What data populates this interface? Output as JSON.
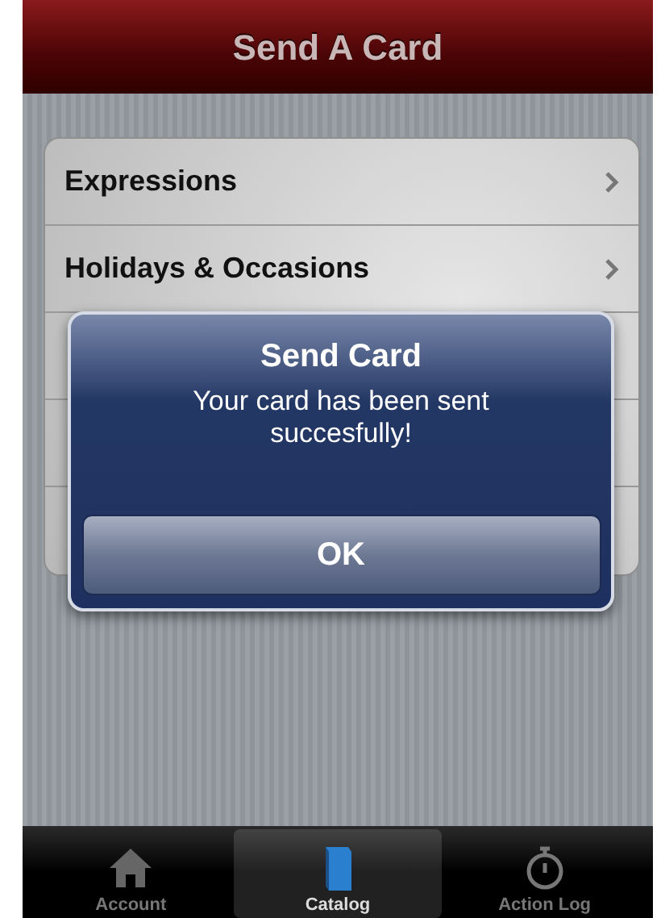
{
  "nav_bar": {
    "title": "Send A Card"
  },
  "list": [
    {
      "label": "Expressions"
    },
    {
      "label": "Holidays & Occasions"
    }
  ],
  "alert": {
    "title": "Send Card",
    "message": "Your card has been sent succesfully!",
    "button": "OK"
  },
  "tab_bar": [
    {
      "label": "Account",
      "selected": false
    },
    {
      "label": "Catalog",
      "selected": true
    },
    {
      "label": "Action Log",
      "selected": false
    }
  ]
}
